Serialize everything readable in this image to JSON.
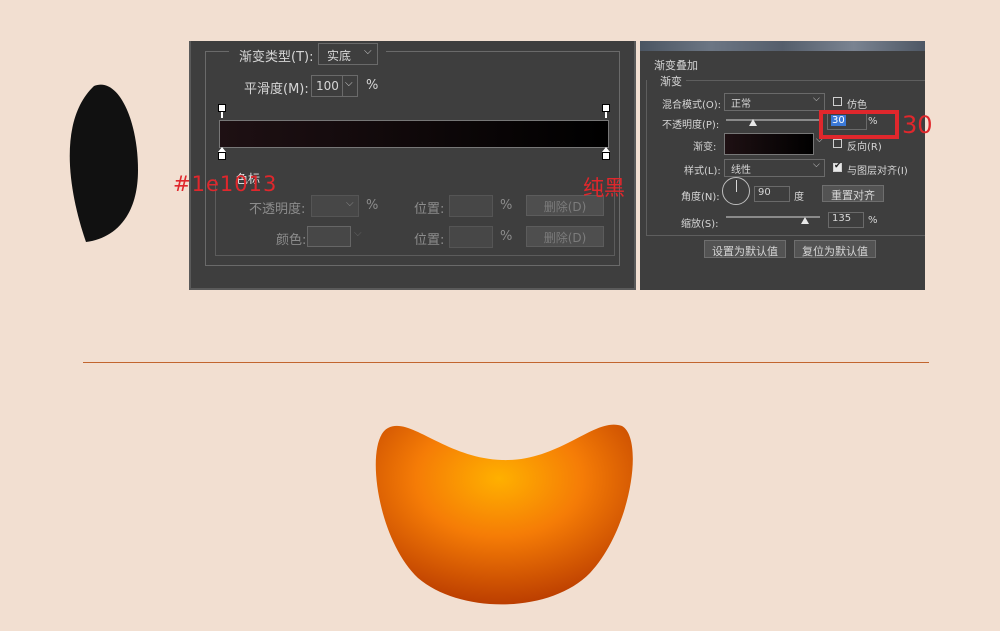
{
  "gradient_editor": {
    "type_label": "渐变类型(T):",
    "type_value": "实底",
    "smoothness_label": "平滑度(M):",
    "smoothness_value": "100",
    "percent": "%",
    "stops_group": "色标",
    "opacity_label": "不透明度:",
    "location_label": "位置:",
    "delete_label": "删除(D)",
    "color_label": "颜色:",
    "gradient_from": "#1e1013",
    "gradient_to": "#000000"
  },
  "layer_style": {
    "section_title": "渐变叠加",
    "group_title": "渐变",
    "blend_mode_label": "混合模式(O):",
    "blend_mode_value": "正常",
    "dither_label": "仿色",
    "opacity_label": "不透明度(P):",
    "opacity_value": "30",
    "opacity_unit": "%",
    "opacity_level": 0.3,
    "gradient_label": "渐变:",
    "reverse_label": "反向(R)",
    "style_label": "样式(L):",
    "style_value": "线性",
    "align_label": "与图层对齐(I)",
    "angle_label": "角度(N):",
    "angle_value": "90",
    "angle_unit": "度",
    "reset_align_button": "重置对齐",
    "scale_label": "缩放(S):",
    "scale_value": "135",
    "scale_unit": "%",
    "scale_level": 1.35,
    "set_default_button": "设置为默认值",
    "reset_default_button": "复位为默认值"
  },
  "annotations": {
    "color_code": "#1e1013",
    "pure_black": "纯黑",
    "opacity_callout": "30"
  },
  "colors": {
    "background": "#f2dfd1",
    "panel": "#3e3e3e",
    "highlight": "#e0272c",
    "divider": "#c2652e",
    "orange_light": "#ffb000",
    "orange_dark": "#b83a00"
  }
}
